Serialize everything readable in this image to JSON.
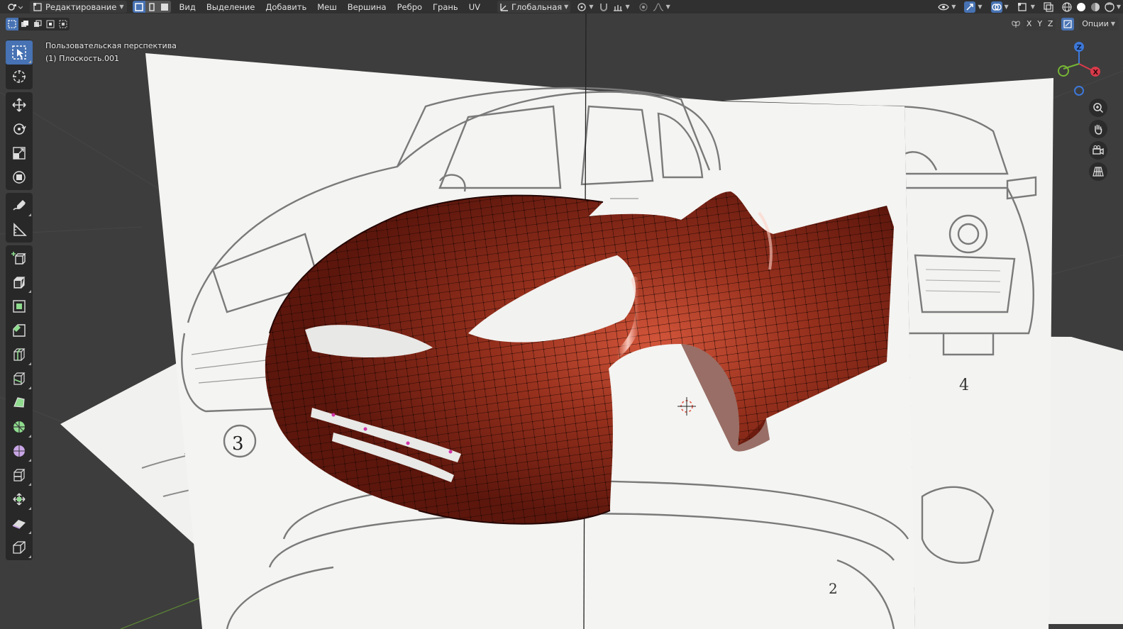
{
  "header": {
    "mode_label": "Редактирование",
    "menu": [
      "Вид",
      "Выделение",
      "Добавить",
      "Меш",
      "Вершина",
      "Ребро",
      "Грань",
      "UV"
    ],
    "orientation_label": "Глобальная"
  },
  "subheader": {
    "axes": [
      "X",
      "Y",
      "Z"
    ],
    "options_label": "Опции"
  },
  "viewport": {
    "view_name": "Пользовательская перспектива",
    "object_name": "(1) Плоскость.001",
    "ref_numbers": [
      "3",
      "4",
      "2"
    ]
  },
  "gizmo": {
    "x": "X",
    "y": "Y",
    "z": "Z"
  },
  "colors": {
    "header_bg": "#303030",
    "viewport_bg": "#3d3d3d",
    "accent": "#4772b3",
    "mesh": "#8e2a18",
    "x_axis": "#d83a4a",
    "y_axis": "#76b534",
    "z_axis": "#3d78d9"
  },
  "icons": {
    "toolbar": [
      "select-box-icon",
      "cursor-icon",
      "move-icon",
      "rotate-icon",
      "scale-icon",
      "transform-icon",
      "annotate-icon",
      "measure-icon",
      "add-cube-icon",
      "extrude-icon",
      "inset-icon",
      "bevel-icon",
      "loop-cut-icon",
      "knife-icon",
      "poly-build-icon",
      "spin-icon",
      "smooth-icon",
      "edge-slide-icon",
      "shrink-fatten-icon",
      "shear-icon",
      "rip-region-icon"
    ],
    "nav": [
      "zoom-icon",
      "pan-hand-icon",
      "camera-view-icon",
      "ortho-grid-icon"
    ]
  }
}
